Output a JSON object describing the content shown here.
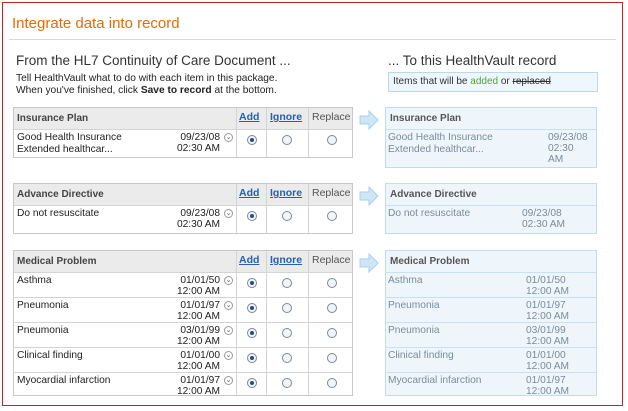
{
  "title": "Integrate data into record",
  "left_heading": "From the HL7 Continuity of Care Document ...",
  "right_heading": "... To this HealthVault record",
  "intro": {
    "line1": "Tell HealthVault what to do with each item in this package.",
    "line2_pre": "When you've finished, click ",
    "line2_bold": "Save to record",
    "line2_post": " at the bottom."
  },
  "legend": {
    "pre": "Items that will be ",
    "added": "added",
    "mid": " or ",
    "replaced": "replaced"
  },
  "columns": {
    "add": "Add",
    "ignore": "Ignore",
    "replace": "Replace"
  },
  "sections": [
    {
      "title": "Insurance Plan",
      "rows": [
        {
          "name": "Good Health Insurance\nExtended healthcar...",
          "date": "09/23/08\n02:30 AM",
          "choice": "add"
        }
      ]
    },
    {
      "title": "Advance Directive",
      "rows": [
        {
          "name": "Do not resuscitate",
          "date": "09/23/08\n02:30 AM",
          "choice": "add"
        }
      ]
    },
    {
      "title": "Medical Problem",
      "rows": [
        {
          "name": "Asthma",
          "date": "01/01/50\n12:00 AM",
          "choice": "add"
        },
        {
          "name": "Pneumonia",
          "date": "01/01/97\n12:00 AM",
          "choice": "add"
        },
        {
          "name": "Pneumonia",
          "date": "03/01/99\n12:00 AM",
          "choice": "add"
        },
        {
          "name": "Clinical finding",
          "date": "01/01/00\n12:00 AM",
          "choice": "add"
        },
        {
          "name": "Myocardial infarction",
          "date": "01/01/97\n12:00 AM",
          "choice": "add"
        }
      ]
    }
  ],
  "record_sections": [
    {
      "title": "Insurance Plan",
      "rows": [
        {
          "name": "Good Health Insurance\nExtended healthcar...",
          "date": "09/23/08\n02:30\nAM"
        }
      ]
    },
    {
      "title": "Advance Directive",
      "rows": [
        {
          "name": "Do not resuscitate",
          "date": "09/23/08\n02:30 AM"
        }
      ]
    },
    {
      "title": "Medical Problem",
      "rows": [
        {
          "name": "Asthma",
          "date": "01/01/50\n12:00 AM"
        },
        {
          "name": "Pneumonia",
          "date": "01/01/97\n12:00 AM"
        },
        {
          "name": "Pneumonia",
          "date": "03/01/99\n12:00 AM"
        },
        {
          "name": "Clinical finding",
          "date": "01/01/00\n12:00 AM"
        },
        {
          "name": "Myocardial infarction",
          "date": "01/01/97\n12:00 AM"
        }
      ]
    }
  ]
}
